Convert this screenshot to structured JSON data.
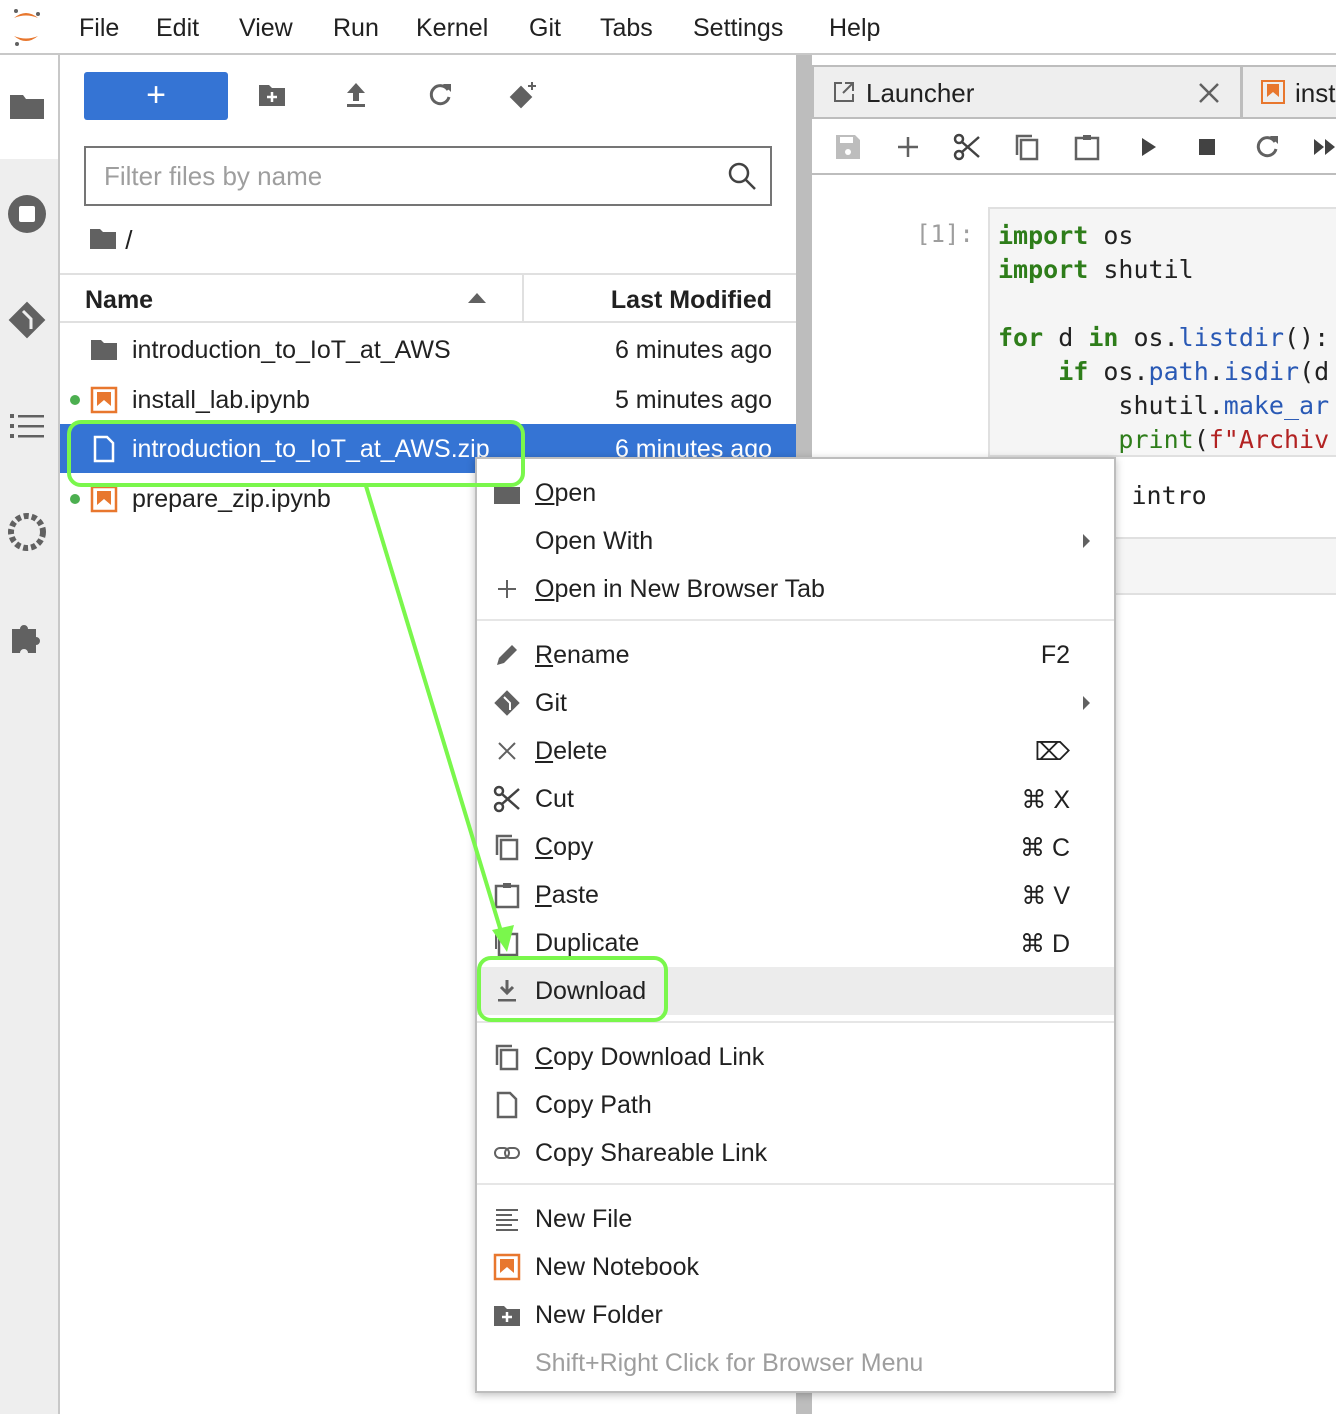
{
  "menubar": {
    "items": [
      "File",
      "Edit",
      "View",
      "Run",
      "Kernel",
      "Git",
      "Tabs",
      "Settings",
      "Help"
    ]
  },
  "activity_bar": {
    "icons": [
      "folder-icon",
      "running-icon",
      "git-icon",
      "toc-icon",
      "palette-icon",
      "extension-icon"
    ]
  },
  "file_browser": {
    "new_button": "+",
    "filter_placeholder": "Filter files by name",
    "breadcrumb": "/",
    "columns": {
      "name": "Name",
      "modified": "Last Modified"
    },
    "rows": [
      {
        "name": "introduction_to_IoT_at_AWS",
        "modified": "6 minutes ago",
        "type": "folder",
        "running": false,
        "selected": false
      },
      {
        "name": "install_lab.ipynb",
        "modified": "5 minutes ago",
        "type": "notebook",
        "running": true,
        "selected": false
      },
      {
        "name": "introduction_to_IoT_at_AWS.zip",
        "modified": "6 minutes ago",
        "type": "file",
        "running": false,
        "selected": true
      },
      {
        "name": "prepare_zip.ipynb",
        "modified": "",
        "type": "notebook",
        "running": true,
        "selected": false
      }
    ]
  },
  "main": {
    "tabs": [
      {
        "label": "Launcher"
      },
      {
        "label": "inst"
      }
    ],
    "prompt": "[1]:",
    "output": "created: intro"
  },
  "context_menu": {
    "items": [
      {
        "label": "Open",
        "icon": "folder-icon",
        "shortcut": ""
      },
      {
        "label": "Open With",
        "icon": "",
        "shortcut": "",
        "submenu": true
      },
      {
        "label": "Open in New Browser Tab",
        "icon": "plus-icon",
        "shortcut": ""
      },
      {
        "label": "Rename",
        "icon": "pencil-icon",
        "shortcut": "F2"
      },
      {
        "label": "Git",
        "icon": "git-icon",
        "shortcut": "",
        "submenu": true
      },
      {
        "label": "Delete",
        "icon": "close-icon",
        "shortcut": "⌦"
      },
      {
        "label": "Cut",
        "icon": "scissors-icon",
        "shortcut": "⌘ X"
      },
      {
        "label": "Copy",
        "icon": "copy-icon",
        "shortcut": "⌘ C"
      },
      {
        "label": "Paste",
        "icon": "paste-icon",
        "shortcut": "⌘ V"
      },
      {
        "label": "Duplicate",
        "icon": "duplicate-icon",
        "shortcut": "⌘ D"
      },
      {
        "label": "Download",
        "icon": "download-icon",
        "shortcut": "",
        "highlighted": true
      },
      {
        "label": "Copy Download Link",
        "icon": "copy-icon",
        "shortcut": ""
      },
      {
        "label": "Copy Path",
        "icon": "file-icon",
        "shortcut": ""
      },
      {
        "label": "Copy Shareable Link",
        "icon": "link-icon",
        "shortcut": ""
      },
      {
        "label": "New File",
        "icon": "text-file-icon",
        "shortcut": ""
      },
      {
        "label": "New Notebook",
        "icon": "notebook-icon",
        "shortcut": ""
      },
      {
        "label": "New Folder",
        "icon": "new-folder-icon",
        "shortcut": ""
      },
      {
        "label": "Shift+Right Click for Browser Menu",
        "icon": "",
        "shortcut": ""
      }
    ]
  },
  "colors": {
    "accent": "#3574d4",
    "annotation": "#7af74c",
    "notebook": "#e8772e",
    "keyword": "#2e7d1a",
    "function": "#2959b5",
    "string": "#b22222"
  }
}
